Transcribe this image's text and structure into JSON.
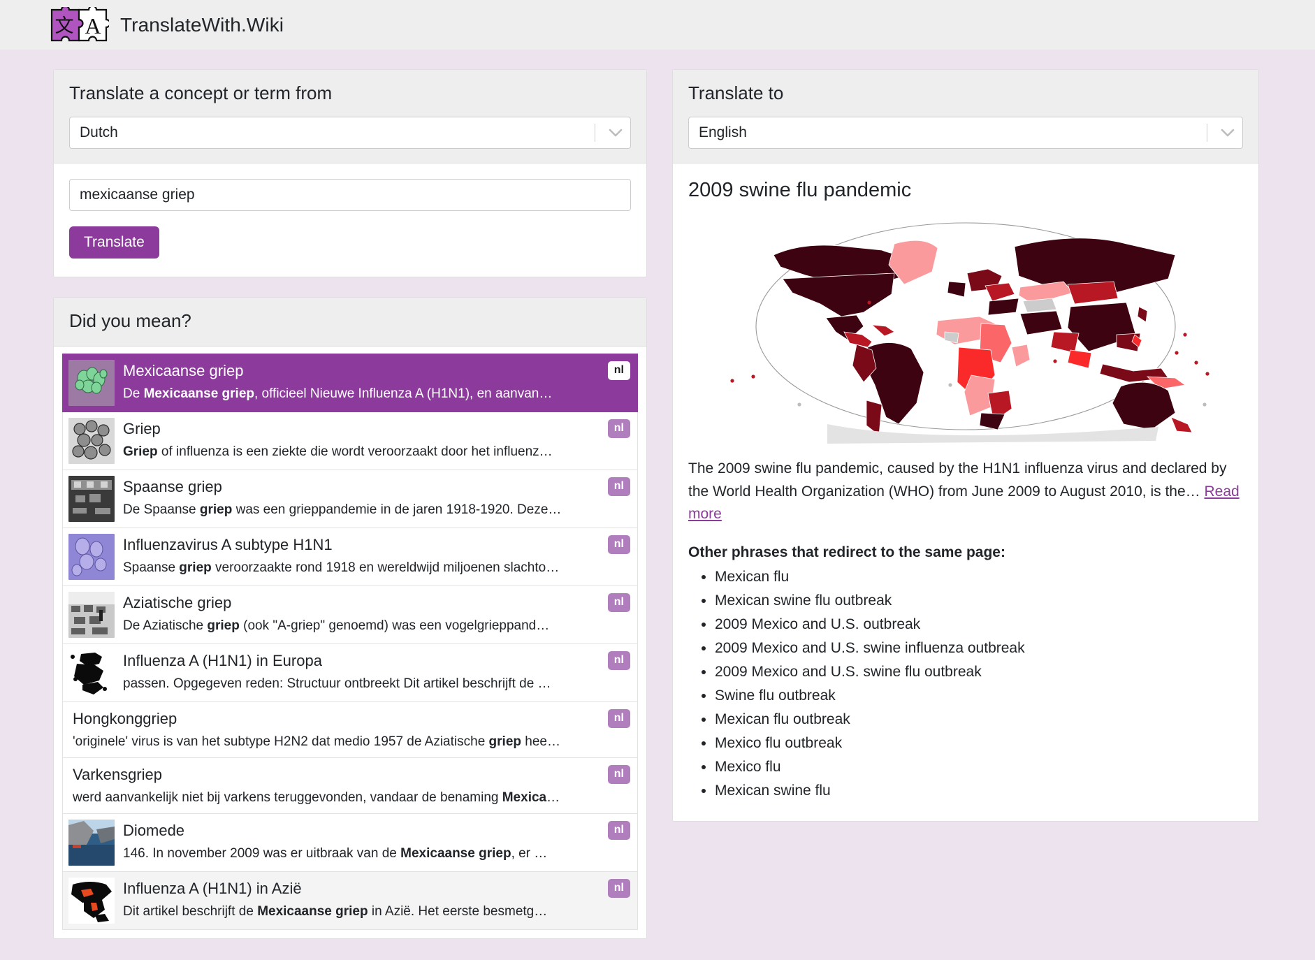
{
  "header": {
    "brand": "TranslateWith.Wiki",
    "logo_icon": "puzzle-piece-logo",
    "logo_left_glyph": "文",
    "logo_right_glyph": "A"
  },
  "source_panel": {
    "title": "Translate a concept or term from",
    "language_select": {
      "value": "Dutch",
      "icon": "chevron-down-icon"
    },
    "term_input": {
      "value": "mexicaanse griep",
      "placeholder": ""
    },
    "translate_button": "Translate"
  },
  "suggestions_panel": {
    "title": "Did you mean?",
    "items": [
      {
        "title": "Mexicaanse griep",
        "desc_pre": "De ",
        "desc_bold": "Mexicaanse griep",
        "desc_post": ", officieel Nieuwe Influenza A (H1N1), en aanvan…",
        "badge": "nl",
        "thumb": "virus-green-cluster",
        "selected": true,
        "hover": false
      },
      {
        "title": "Griep",
        "desc_pre": "",
        "desc_bold": "Griep",
        "desc_post": " of influenza is een ziekte die wordt veroorzaakt door het influenz…",
        "badge": "nl",
        "thumb": "virus-grayscale",
        "selected": false,
        "hover": false
      },
      {
        "title": "Spaanse griep",
        "desc_pre": "De Spaanse ",
        "desc_bold": "griep",
        "desc_post": " was een grieppandemie in de jaren 1918-1920. Deze…",
        "badge": "nl",
        "thumb": "historic-ward-dark",
        "selected": false,
        "hover": false
      },
      {
        "title": "Influenzavirus A subtype H1N1",
        "desc_pre": "Spaanse ",
        "desc_bold": "griep",
        "desc_post": " veroorzaakte rond 1918 en wereldwijd miljoenen slachto…",
        "badge": "nl",
        "thumb": "virus-purple",
        "selected": false,
        "hover": false
      },
      {
        "title": "Aziatische griep",
        "desc_pre": "De Aziatische ",
        "desc_bold": "griep",
        "desc_post": " (ook \"A-griep\" genoemd) was een vogelgrieppand…",
        "badge": "nl",
        "thumb": "hospital-bw",
        "selected": false,
        "hover": false
      },
      {
        "title": "Influenza A (H1N1) in Europa",
        "desc_pre": "passen. Opgegeven reden: Structuur ontbreekt Dit artikel beschrijft de …",
        "desc_bold": "",
        "desc_post": "",
        "badge": "nl",
        "thumb": "europe-map-bw",
        "selected": false,
        "hover": false
      },
      {
        "title": "Hongkonggriep",
        "desc_pre": "'originele' virus is van het subtype H2N2 dat medio 1957 de Aziatische ",
        "desc_bold": "griep",
        "desc_post": " hee…",
        "badge": "nl",
        "thumb": "",
        "selected": false,
        "hover": false
      },
      {
        "title": "Varkensgriep",
        "desc_pre": "werd aanvankelijk niet bij varkens teruggevonden, vandaar de benaming ",
        "desc_bold": "Mexica",
        "desc_post": "…",
        "badge": "nl",
        "thumb": "",
        "selected": false,
        "hover": false
      },
      {
        "title": "Diomede",
        "desc_pre": "146. In november 2009 was er uitbraak van de ",
        "desc_bold": "Mexicaanse griep",
        "desc_post": ", er …",
        "badge": "nl",
        "thumb": "coast-photo",
        "selected": false,
        "hover": false
      },
      {
        "title": "Influenza A (H1N1) in Azië",
        "desc_pre": "Dit artikel beschrijft de ",
        "desc_bold": "Mexicaanse griep",
        "desc_post": " in Azië. Het eerste besmetg…",
        "badge": "nl",
        "thumb": "asia-map-bw",
        "selected": false,
        "hover": true
      }
    ]
  },
  "target_panel": {
    "title": "Translate to",
    "language_select": {
      "value": "English",
      "icon": "chevron-down-icon"
    },
    "result": {
      "title": "2009 swine flu pandemic",
      "map_alt": "world-map-pandemic-spread",
      "summary_text": "The 2009 swine flu pandemic, caused by the H1N1 influenza virus and declared by the World Health Organization (WHO) from June 2009 to August 2010, is the… ",
      "read_more": "Read more",
      "redirect_heading": "Other phrases that redirect to the same page:",
      "redirects": [
        "Mexican flu",
        "Mexican swine flu outbreak",
        "2009 Mexico and U.S. outbreak",
        "2009 Mexico and U.S. swine influenza outbreak",
        "2009 Mexico and U.S. swine flu outbreak",
        "Swine flu outbreak",
        "Mexican flu outbreak",
        "Mexico flu outbreak",
        "Mexico flu",
        "Mexican swine flu"
      ]
    }
  },
  "colors": {
    "accent": "#8c3a9b",
    "page_bg": "#ece3ef",
    "panel_head_bg": "#eeeeee",
    "badge_bg": "#b07ebd"
  }
}
